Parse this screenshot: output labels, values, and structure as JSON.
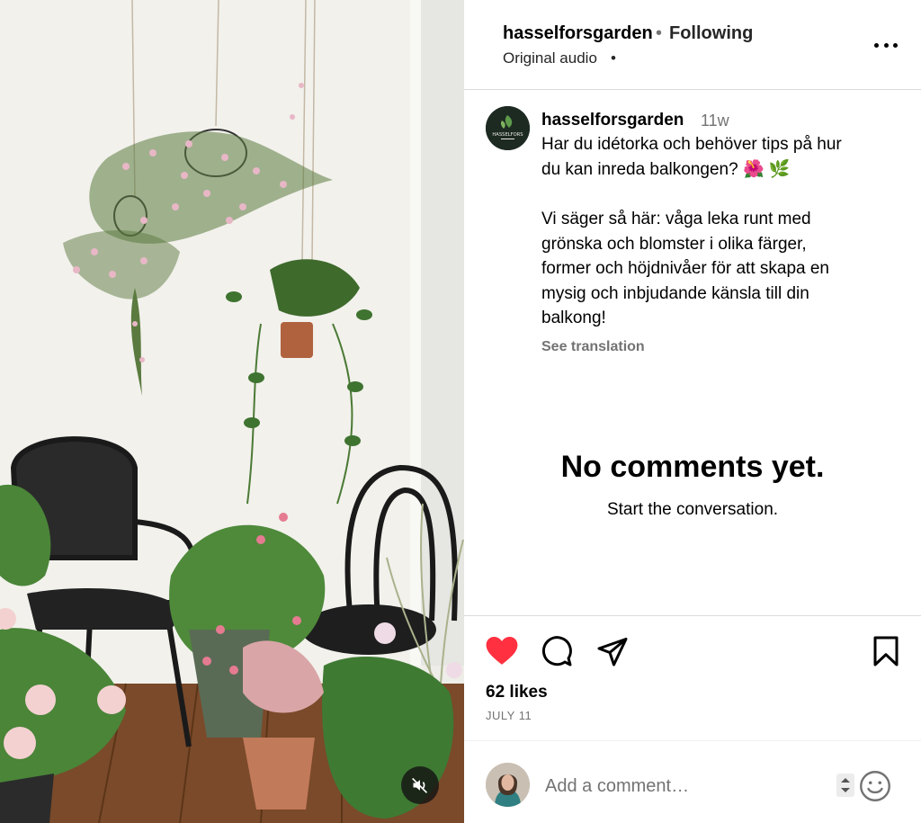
{
  "header": {
    "username": "hasselforsgarden",
    "separator": "•",
    "follow_label": "Following",
    "audio_label": "Original audio",
    "audio_dot": "•"
  },
  "caption": {
    "avatar_text": "HASSELFORS",
    "username": "hasselforsgarden",
    "time_ago": "11w",
    "lines": [
      "Har du idétorka och behöver tips på hur",
      "du kan inreda balkongen? 🌺 🌿",
      "",
      "Vi säger så här: våga leka runt med",
      "grönska och blomster i olika färger,",
      "former och höjdnivåer för att skapa en",
      "mysig och inbjudande känsla till din",
      "balkong!"
    ],
    "see_translation": "See translation"
  },
  "comments": {
    "empty_title": "No comments yet.",
    "empty_subtitle": "Start the conversation."
  },
  "actions": {
    "liked": true,
    "like_color": "#ff3040",
    "likes": "62 likes",
    "date": "JULY 11"
  },
  "comment_box": {
    "placeholder": "Add a comment…"
  },
  "icons": {
    "more": "more-icon",
    "like": "heart-icon",
    "comment": "comment-icon",
    "share": "share-icon",
    "save": "bookmark-icon",
    "mute": "speaker-muted-icon",
    "emoji": "emoji-icon"
  }
}
